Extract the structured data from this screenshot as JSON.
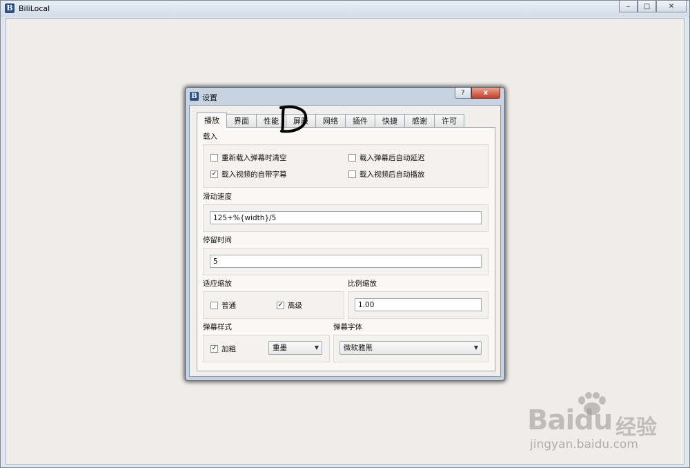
{
  "window": {
    "title": "BiliLocal",
    "icon": "B",
    "buttons": [
      "minimize-icon",
      "maximize-icon",
      "close-icon"
    ]
  },
  "dialog": {
    "title": "设置",
    "icon": "B",
    "help_label": "?",
    "close_label": "x",
    "tabs": [
      {
        "label": "播放",
        "active": true
      },
      {
        "label": "界面"
      },
      {
        "label": "性能"
      },
      {
        "label": "屏蔽"
      },
      {
        "label": "网络"
      },
      {
        "label": "插件"
      },
      {
        "label": "快捷"
      },
      {
        "label": "感谢"
      },
      {
        "label": "许可"
      }
    ],
    "load_group": {
      "title": "载入",
      "options": [
        {
          "label": "重新载入弹幕时清空",
          "checked": false
        },
        {
          "label": "载入弹幕后自动延迟",
          "checked": false
        },
        {
          "label": "载入视频的自带字幕",
          "checked": true
        },
        {
          "label": "载入视频后自动播放",
          "checked": false
        }
      ]
    },
    "scroll_speed": {
      "title": "滑动速度",
      "value": "125+%{width}/5"
    },
    "stay_time": {
      "title": "停留时间",
      "value": "5"
    },
    "adaptive_scale": {
      "title": "适应缩放",
      "options": [
        {
          "label": "普通",
          "checked": false
        },
        {
          "label": "高级",
          "checked": true
        }
      ]
    },
    "ratio_scale": {
      "title": "比例缩放",
      "value": "1.00"
    },
    "danmaku_style": {
      "title": "弹幕样式",
      "bold": {
        "label": "加粗",
        "checked": true
      },
      "effect": "重墨"
    },
    "danmaku_font": {
      "title": "弹幕字体",
      "value": "微软雅黑"
    }
  },
  "annotation": {
    "mark_label": "D"
  },
  "watermark": {
    "brand": "Bai",
    "brand2": "du",
    "cn": "经验",
    "url": "jingyan.baidu.com"
  },
  "colors": {
    "accent": "#2a4f86",
    "close_red": "#c3402c",
    "client_bg": "#efedea"
  }
}
